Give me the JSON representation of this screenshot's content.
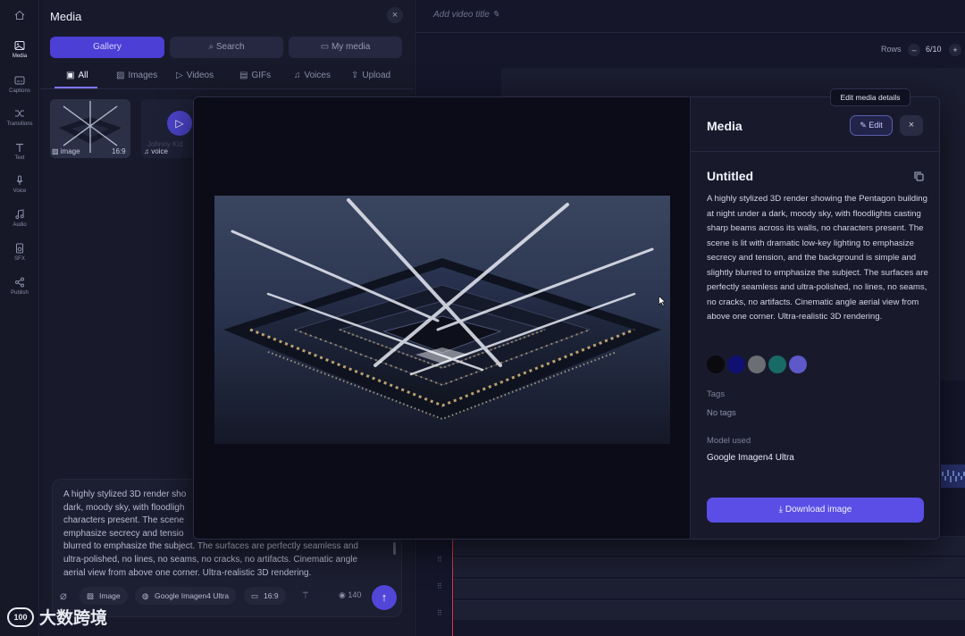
{
  "sidebar": {
    "items": [
      {
        "label": "",
        "icon": "home-icon"
      },
      {
        "label": "Media",
        "icon": "image-icon"
      },
      {
        "label": "Captions",
        "icon": "captions-icon"
      },
      {
        "label": "Transitions",
        "icon": "shuffle-icon"
      },
      {
        "label": "Text",
        "icon": "text-icon"
      },
      {
        "label": "Voice",
        "icon": "mic-icon"
      },
      {
        "label": "Audio",
        "icon": "music-icon"
      },
      {
        "label": "SFX",
        "icon": "speaker-icon"
      },
      {
        "label": "Publish",
        "icon": "share-icon"
      }
    ]
  },
  "media_panel": {
    "title": "Media",
    "segments": [
      "Gallery",
      "Search",
      "My media"
    ],
    "filter_tabs": [
      "All",
      "Images",
      "Videos",
      "GIFs",
      "Voices",
      "Upload"
    ],
    "thumbnails": [
      {
        "type": "image",
        "ratio": "16:9"
      },
      {
        "type": "voice",
        "caption": "Johnny Kid"
      }
    ],
    "prompt": {
      "text": "A highly stylized 3D render sho\ndark, moody sky, with floodligh\ncharacters present. The scene\nemphasize secrecy and tensio\nblurred to emphasize the subject. The surfaces are perfectly seamless and\nultra-polished, no lines, no seams, no cracks, no artifacts. Cinematic angle\naerial view from above one corner. Ultra-realistic 3D rendering.",
      "chips": [
        "Image",
        "Google Imagen4 Ultra",
        "16:9"
      ],
      "credits": "140"
    }
  },
  "editor": {
    "video_title_placeholder": "Add video title",
    "rows_label": "Rows",
    "rows_value": "6/10",
    "rows_minus": "–",
    "rows_plus": "+"
  },
  "modal": {
    "header": "Media",
    "edit_label": "Edit",
    "tooltip": "Edit media details",
    "close": "×",
    "item_title": "Untitled",
    "description": "A highly stylized 3D render showing the Pentagon building at night under a dark, moody sky, with floodlights casting sharp beams across its walls, no characters present. The scene is lit with dramatic low-key lighting to emphasize secrecy and tension, and the background is simple and slightly blurred to emphasize the subject. The surfaces are perfectly seamless and ultra-polished, no lines, no seams, no cracks, no artifacts. Cinematic angle aerial view from above one corner. Ultra-realistic 3D rendering.",
    "palette": [
      "#0a0a0f",
      "#101070",
      "#6b6e73",
      "#186a66",
      "#5f58c8"
    ],
    "tags_label": "Tags",
    "tags_value": "No tags",
    "model_label": "Model used",
    "model_value": "Google Imagen4 Ultra",
    "download_label": "Download image"
  },
  "watermark": {
    "text": "大数跨境",
    "badge": "100"
  }
}
